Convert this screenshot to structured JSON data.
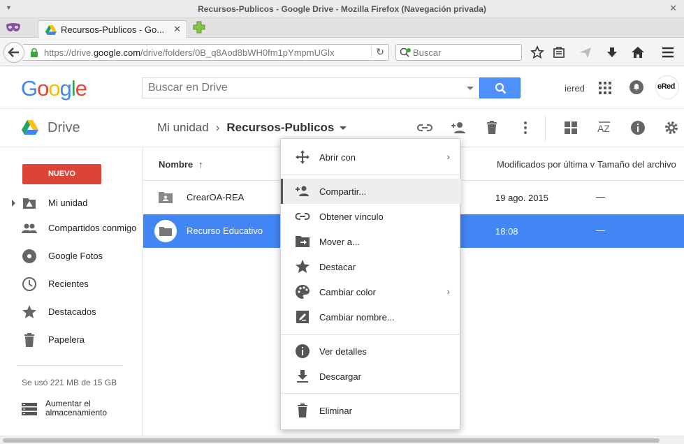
{
  "window": {
    "title": "Recursos-Publicos - Google Drive - Mozilla Firefox (Navegación privada)"
  },
  "browser": {
    "tab_title": "Recursos-Publicos - Go...",
    "url_prefix": "https://drive.",
    "url_domain": "google.com",
    "url_path": "/drive/folders/0B_q8Aod8bWH0fm1pYmpmUGlx",
    "search_placeholder": "Buscar"
  },
  "google": {
    "logo": "Google",
    "search_placeholder": "Buscar en Drive",
    "user_name": "iered",
    "avatar_text": "eRed"
  },
  "drive": {
    "product": "Drive",
    "breadcrumb_root": "Mi unidad",
    "breadcrumb_current": "Recursos-Publicos"
  },
  "sidebar": {
    "new_button": "NUEVO",
    "items": [
      {
        "label": "Mi unidad",
        "icon": "my-drive-icon"
      },
      {
        "label": "Compartidos conmigo",
        "icon": "shared-people-icon"
      },
      {
        "label": "Google Fotos",
        "icon": "photos-icon"
      },
      {
        "label": "Recientes",
        "icon": "clock-icon"
      },
      {
        "label": "Destacados",
        "icon": "star-icon"
      },
      {
        "label": "Papelera",
        "icon": "trash-icon"
      }
    ],
    "storage": "Se usó 221 MB de 15 GB",
    "upgrade": [
      "Aumentar el",
      "almacenamiento"
    ]
  },
  "list": {
    "col_name": "Nombre",
    "col_name_sort": "↑",
    "col_modified": "Modificados por última v",
    "col_size": "Tamaño del archivo",
    "rows": [
      {
        "name": "CrearOA-REA",
        "modified": "19 ago. 2015",
        "size": "—",
        "selected": false
      },
      {
        "name": "Recurso Educativo",
        "modified": "18:08",
        "size": "—",
        "selected": true
      }
    ]
  },
  "context_menu": {
    "items": [
      {
        "label": "Abrir con",
        "submenu": "›"
      },
      {
        "label": "Compartir..."
      },
      {
        "label": "Obtener vínculo"
      },
      {
        "label": "Mover a..."
      },
      {
        "label": "Destacar"
      },
      {
        "label": "Cambiar color",
        "submenu": "›"
      },
      {
        "label": "Cambiar nombre..."
      },
      {
        "label": "Ver detalles"
      },
      {
        "label": "Descargar"
      },
      {
        "label": "Eliminar"
      }
    ]
  },
  "colors": {
    "accent_blue": "#4285f4",
    "new_red": "#db4437",
    "search_blue": "#4d90fe"
  }
}
